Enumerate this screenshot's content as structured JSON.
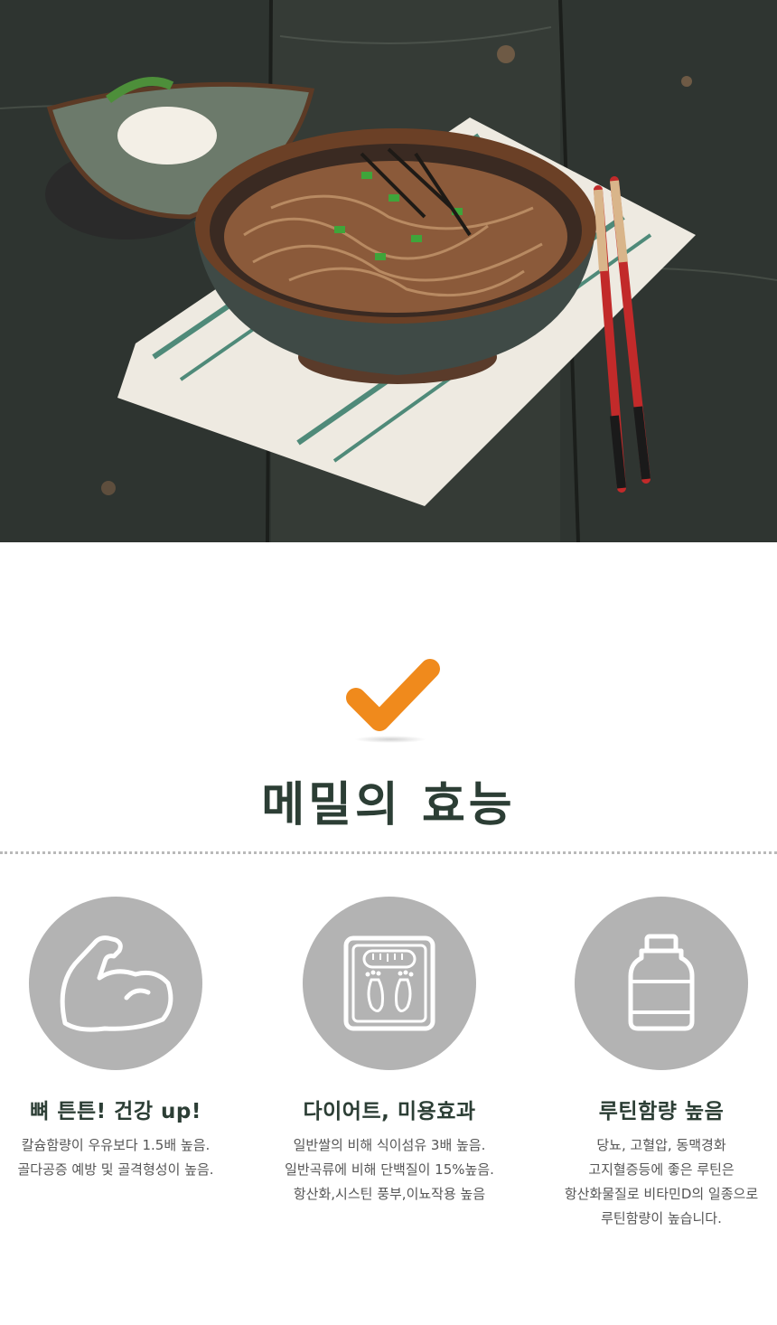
{
  "hero": {
    "image": "buckwheat-noodle-bowl-photo"
  },
  "section": {
    "title": "메밀의 효능",
    "accent_color": "#f08a1c",
    "title_color": "#2c3e35"
  },
  "benefits": [
    {
      "icon": "muscle-arm-icon",
      "title": "뼈 튼튼! 건강 up!",
      "lines": [
        "칼슘함량이 우유보다 1.5배 높음.",
        "골다공증 예방 및 골격형성이 높음."
      ]
    },
    {
      "icon": "weight-scale-icon",
      "title": "다이어트, 미용효과",
      "lines": [
        "일반쌀의 비해 식이섬유 3배 높음.",
        "일반곡류에 비해 단백질이 15%높음.",
        "항산화,시스틴 풍부,이뇨작용 높음"
      ]
    },
    {
      "icon": "supplement-bottle-icon",
      "title": "루틴함량 높음",
      "lines": [
        "당뇨, 고혈압, 동맥경화",
        "고지혈증등에 좋은 루틴은",
        "항산화물질로 비타민D의 일종으로",
        "루틴함량이 높습니다."
      ]
    }
  ]
}
